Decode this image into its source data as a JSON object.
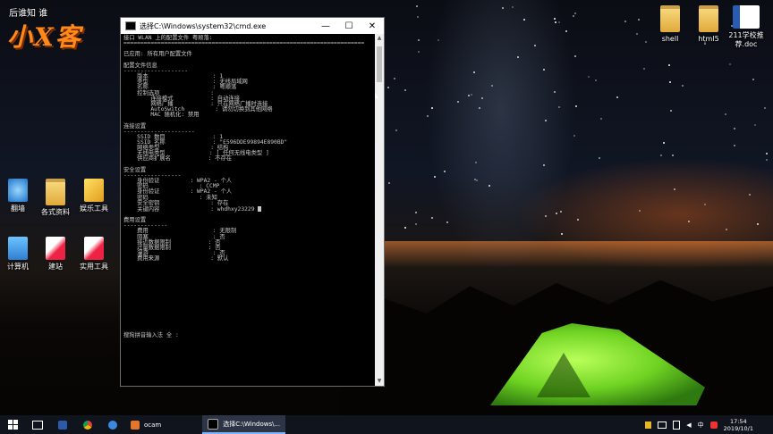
{
  "desktop": {
    "watermark": {
      "top": "后谁知 谁",
      "brand": "小X客"
    },
    "icons_right": [
      {
        "label": "shell",
        "kind": "folder"
      },
      {
        "label": "html5",
        "kind": "folder"
      },
      {
        "label": "211学校推荐.doc",
        "kind": "doc"
      }
    ],
    "icons_left": [
      {
        "label": "翻墙",
        "kind": "app"
      },
      {
        "label": "各式资料",
        "kind": "folder"
      },
      {
        "label": "娱乐工具",
        "kind": "tool"
      },
      {
        "label": "计算机",
        "kind": "pc"
      },
      {
        "label": "建站",
        "kind": "folder"
      },
      {
        "label": "实用工具",
        "kind": "tool"
      }
    ]
  },
  "window": {
    "title": "选择C:\\Windows\\system32\\cmd.exe",
    "minimize": "—",
    "maximize": "☐",
    "close": "✕"
  },
  "console": {
    "lines": [
      "接口 WLAN 上的配置文件 粤顺落:",
      "=======================================================================",
      "",
      "已应用: 所有用户配置文件",
      "",
      "配置文件信息",
      "-------------------",
      "    版本                   : 1",
      "    类型                   : 无线局域网",
      "    名称                   : 粤顺落",
      "    控制选项               :",
      "        连接模式           : 自动连接",
      "        网络广播           : 只在网络广播时连接",
      "        AutoSwitch         : 请勿切换到其他网络",
      "        MAC 随机化: 禁用",
      "",
      "连接设置",
      "---------------------",
      "    SSID 数目              : 1",
      "    SSID 名称              : \"E596DDE99894E890BD\"",
      "    网络类型               : 结构",
      "    无线电类型             : [ 任何无线电类型 ]",
      "    供应商扩展名           : 不存在",
      "",
      "安全设置",
      "-----------------",
      "    身份验证         : WPA2 - 个人",
      "    密码               : CCMP",
      "    身份验证         : WPA2 - 个人",
      "    密码               : 未知",
      "    安全密钥               : 存在",
      "    关键内容               : whdhxy23229",
      "",
      "费用设置",
      "-------------",
      "    费用                   : 无限制",
      "    阻塞                   : 否",
      "    接近数据限制           : 否",
      "    过量数据限制           : 否",
      "    漫游                   : 否",
      "    费用来源               : 默认",
      "",
      "",
      "",
      "",
      "",
      "",
      "",
      "",
      "",
      "",
      "",
      "",
      "",
      "搜狗拼音输入法 全 :"
    ]
  },
  "taskbar": {
    "apps": [
      {
        "label": "ocam",
        "active": false
      },
      {
        "label": "选择C:\\Windows\\...",
        "active": true
      }
    ],
    "tray_lang": "中",
    "time": "17:54",
    "date": "2019/10/1"
  }
}
